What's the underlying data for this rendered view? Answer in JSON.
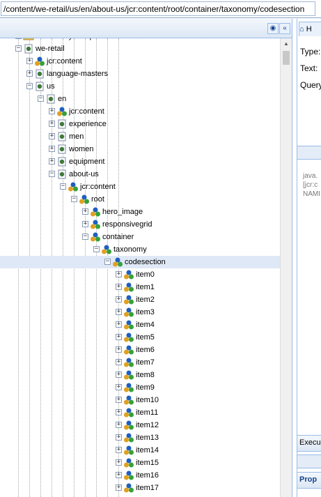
{
  "path_bar": {
    "value": "/content/we-retail/us/en/about-us/jcr:content/root/container/taxonomy/codesection"
  },
  "tree_toolbar": {
    "binoculars_icon": "binoculars-icon",
    "collapse_icon": "double-chevron-left-icon"
  },
  "tree": {
    "nodes": [
      {
        "label": "community-components",
        "depth": 1,
        "icon": "folder",
        "state": "expanded"
      },
      {
        "label": "we-retail",
        "depth": 1,
        "icon": "page",
        "state": "expanded"
      },
      {
        "label": "jcr:content",
        "depth": 2,
        "icon": "component",
        "state": "collapsed"
      },
      {
        "label": "language-masters",
        "depth": 2,
        "icon": "page",
        "state": "collapsed"
      },
      {
        "label": "us",
        "depth": 2,
        "icon": "page",
        "state": "expanded"
      },
      {
        "label": "en",
        "depth": 3,
        "icon": "page",
        "state": "expanded"
      },
      {
        "label": "jcr:content",
        "depth": 4,
        "icon": "component",
        "state": "collapsed"
      },
      {
        "label": "experience",
        "depth": 4,
        "icon": "page",
        "state": "collapsed"
      },
      {
        "label": "men",
        "depth": 4,
        "icon": "page",
        "state": "collapsed"
      },
      {
        "label": "women",
        "depth": 4,
        "icon": "page",
        "state": "collapsed"
      },
      {
        "label": "equipment",
        "depth": 4,
        "icon": "page",
        "state": "collapsed"
      },
      {
        "label": "about-us",
        "depth": 4,
        "icon": "page",
        "state": "expanded"
      },
      {
        "label": "jcr:content",
        "depth": 5,
        "icon": "component",
        "state": "expanded"
      },
      {
        "label": "root",
        "depth": 6,
        "icon": "component",
        "state": "expanded"
      },
      {
        "label": "hero_image",
        "depth": 7,
        "icon": "component",
        "state": "collapsed"
      },
      {
        "label": "responsivegrid",
        "depth": 7,
        "icon": "component",
        "state": "collapsed"
      },
      {
        "label": "container",
        "depth": 7,
        "icon": "component",
        "state": "expanded"
      },
      {
        "label": "taxonomy",
        "depth": 8,
        "icon": "component",
        "state": "expanded"
      },
      {
        "label": "codesection",
        "depth": 9,
        "icon": "component",
        "state": "expanded",
        "selected": true
      },
      {
        "label": "item0",
        "depth": 10,
        "icon": "component",
        "state": "collapsed"
      },
      {
        "label": "item1",
        "depth": 10,
        "icon": "component",
        "state": "collapsed"
      },
      {
        "label": "item2",
        "depth": 10,
        "icon": "component",
        "state": "collapsed"
      },
      {
        "label": "item3",
        "depth": 10,
        "icon": "component",
        "state": "collapsed"
      },
      {
        "label": "item4",
        "depth": 10,
        "icon": "component",
        "state": "collapsed"
      },
      {
        "label": "item5",
        "depth": 10,
        "icon": "component",
        "state": "collapsed"
      },
      {
        "label": "item6",
        "depth": 10,
        "icon": "component",
        "state": "collapsed"
      },
      {
        "label": "item7",
        "depth": 10,
        "icon": "component",
        "state": "collapsed"
      },
      {
        "label": "item8",
        "depth": 10,
        "icon": "component",
        "state": "collapsed"
      },
      {
        "label": "item9",
        "depth": 10,
        "icon": "component",
        "state": "collapsed"
      },
      {
        "label": "item10",
        "depth": 10,
        "icon": "component",
        "state": "collapsed"
      },
      {
        "label": "item11",
        "depth": 10,
        "icon": "component",
        "state": "collapsed"
      },
      {
        "label": "item12",
        "depth": 10,
        "icon": "component",
        "state": "collapsed"
      },
      {
        "label": "item13",
        "depth": 10,
        "icon": "component",
        "state": "collapsed"
      },
      {
        "label": "item14",
        "depth": 10,
        "icon": "component",
        "state": "collapsed"
      },
      {
        "label": "item15",
        "depth": 10,
        "icon": "component",
        "state": "collapsed"
      },
      {
        "label": "item16",
        "depth": 10,
        "icon": "component",
        "state": "collapsed"
      },
      {
        "label": "item17",
        "depth": 10,
        "icon": "component",
        "state": "collapsed"
      }
    ]
  },
  "right_panel": {
    "tab_label": "H",
    "type_label": "Type:",
    "text_label": "Text:",
    "query_label": "Query",
    "code_line1": "java.",
    "code_line2": "[jcr:c",
    "code_line3": "NAMI",
    "execute_label": "Execu",
    "properties_tab": "Prop"
  },
  "colors": {
    "accent_border": "#99bbe8",
    "selected_row": "#dfe8f6",
    "page_icon": "#3f7a3a",
    "component_icon": "#1f5fbf"
  }
}
